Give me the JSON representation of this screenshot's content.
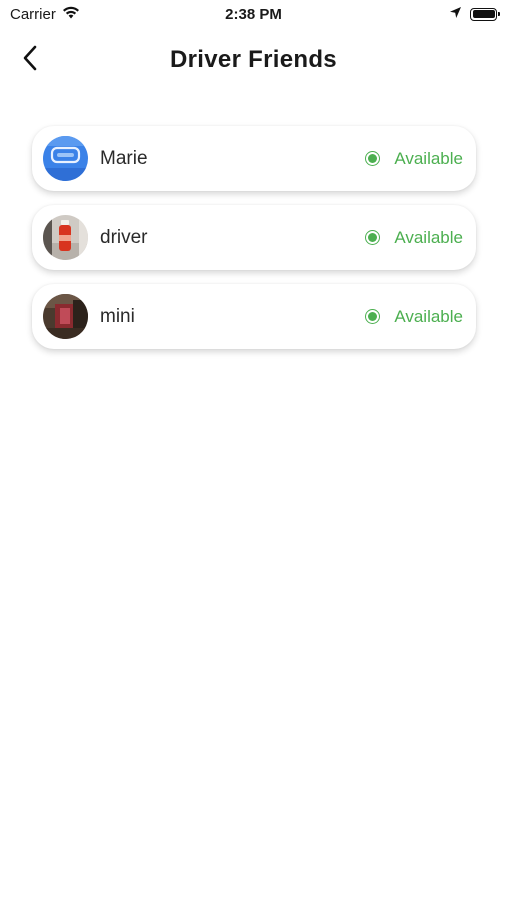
{
  "status_bar": {
    "carrier": "Carrier",
    "time": "2:38 PM",
    "icons": [
      "wifi-icon",
      "location-arrow-icon",
      "battery-icon"
    ]
  },
  "nav": {
    "title": "Driver Friends",
    "back_icon": "chevron-left-icon"
  },
  "colors": {
    "available": "#4caf50",
    "background": "#ffffff",
    "text": "#1a1a1a"
  },
  "friends": [
    {
      "name": "Marie",
      "status": "Available",
      "avatar": "blue-avatar"
    },
    {
      "name": "driver",
      "status": "Available",
      "avatar": "bottle-photo-avatar"
    },
    {
      "name": "mini",
      "status": "Available",
      "avatar": "dark-photo-avatar"
    }
  ]
}
